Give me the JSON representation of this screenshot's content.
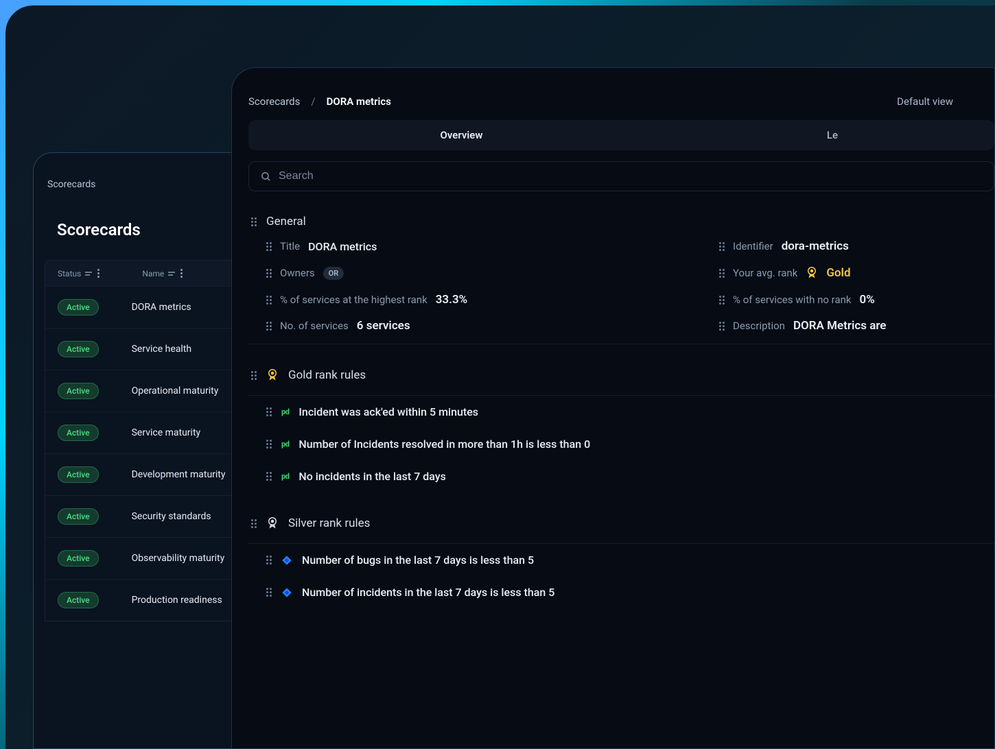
{
  "backCard": {
    "breadcrumb": "Scorecards",
    "title": "Scorecards",
    "columns": {
      "status": "Status",
      "name": "Name"
    },
    "rows": [
      {
        "status": "Active",
        "name": "DORA metrics"
      },
      {
        "status": "Active",
        "name": "Service health"
      },
      {
        "status": "Active",
        "name": "Operational maturity"
      },
      {
        "status": "Active",
        "name": "Service maturity"
      },
      {
        "status": "Active",
        "name": "Development maturity"
      },
      {
        "status": "Active",
        "name": "Security standards"
      },
      {
        "status": "Active",
        "name": "Observability maturity"
      },
      {
        "status": "Active",
        "name": "Production readiness"
      }
    ]
  },
  "frontCard": {
    "breadcrumb": {
      "root": "Scorecards",
      "current": "DORA metrics",
      "viewLabel": "Default view"
    },
    "tabs": {
      "overview": "Overview",
      "other": "Le"
    },
    "search": {
      "placeholder": "Search"
    },
    "general": {
      "heading": "General",
      "titleLabel": "Title",
      "titleValue": "DORA metrics",
      "identifierLabel": "Identifier",
      "identifierValue": "dora-metrics",
      "ownersLabel": "Owners",
      "ownersChip": "OR",
      "avgRankLabel": "Your avg. rank",
      "avgRankValue": "Gold",
      "pctHighestLabel": "% of services at the highest rank",
      "pctHighestValue": "33.3%",
      "pctNoRankLabel": "% of services with no rank",
      "pctNoRankValue": "0%",
      "numServicesLabel": "No. of services",
      "numServicesValue": "6 services",
      "descriptionLabel": "Description",
      "descriptionValue": "DORA Metrics are"
    },
    "goldRules": {
      "heading": "Gold rank rules",
      "rules": [
        "Incident was ack'ed within 5 minutes",
        "Number of Incidents resolved in more than 1h is less than 0",
        "No incidents in the last 7 days"
      ]
    },
    "silverRules": {
      "heading": "Silver rank rules",
      "rules": [
        "Number of bugs in the last 7 days is less than 5",
        "Number of incidents in the last 7 days is less than 5"
      ]
    }
  }
}
